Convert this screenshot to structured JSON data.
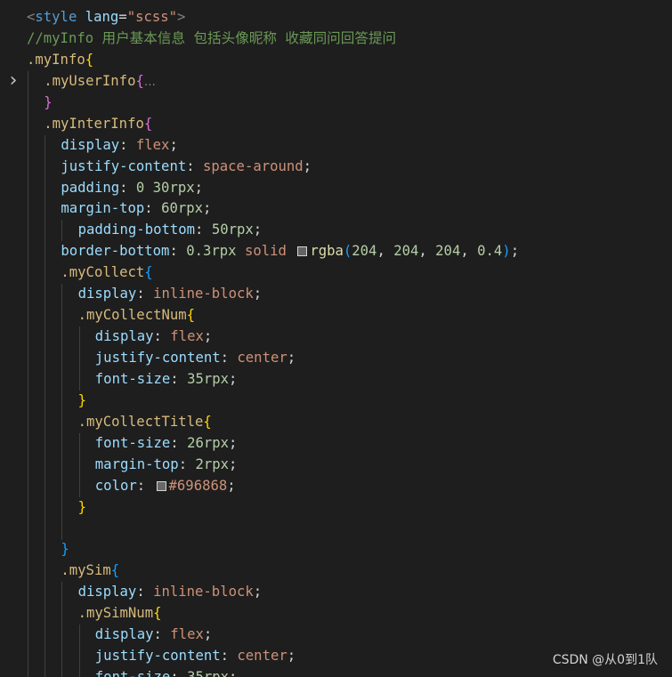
{
  "editor": {
    "language": "scss",
    "lines": [
      {
        "indent": 0,
        "tokens": [
          {
            "t": "<",
            "k": "punc"
          },
          {
            "t": "style",
            "k": "tag"
          },
          {
            "t": " ",
            "k": "text"
          },
          {
            "t": "lang",
            "k": "attr"
          },
          {
            "t": "=",
            "k": "text"
          },
          {
            "t": "\"scss\"",
            "k": "str"
          },
          {
            "t": ">",
            "k": "punc"
          }
        ]
      },
      {
        "indent": 0,
        "tokens": [
          {
            "t": "//myInfo 用户基本信息 包括头像昵称 收藏同问回答提问",
            "k": "comment"
          }
        ]
      },
      {
        "indent": 0,
        "tokens": [
          {
            "t": ".myInfo",
            "k": "sel"
          },
          {
            "t": "{",
            "k": "b1"
          }
        ]
      },
      {
        "indent": 1,
        "fold": "collapsed",
        "tokens": [
          {
            "t": ".myUserInfo",
            "k": "sel"
          },
          {
            "t": "{",
            "k": "b2"
          },
          {
            "t": "…",
            "k": "ellipsis"
          }
        ]
      },
      {
        "indent": 1,
        "tokens": [
          {
            "t": "}",
            "k": "b2"
          }
        ]
      },
      {
        "indent": 1,
        "tokens": [
          {
            "t": ".myInterInfo",
            "k": "sel"
          },
          {
            "t": "{",
            "k": "b2"
          }
        ]
      },
      {
        "indent": 2,
        "tokens": [
          {
            "t": "display",
            "k": "prop"
          },
          {
            "t": ": ",
            "k": "text"
          },
          {
            "t": "flex",
            "k": "value"
          },
          {
            "t": ";",
            "k": "text"
          }
        ]
      },
      {
        "indent": 2,
        "tokens": [
          {
            "t": "justify-content",
            "k": "prop"
          },
          {
            "t": ": ",
            "k": "text"
          },
          {
            "t": "space-around",
            "k": "value"
          },
          {
            "t": ";",
            "k": "text"
          }
        ]
      },
      {
        "indent": 2,
        "tokens": [
          {
            "t": "padding",
            "k": "prop"
          },
          {
            "t": ": ",
            "k": "text"
          },
          {
            "t": "0",
            "k": "num"
          },
          {
            "t": " ",
            "k": "text"
          },
          {
            "t": "30rpx",
            "k": "num"
          },
          {
            "t": ";",
            "k": "text"
          }
        ]
      },
      {
        "indent": 2,
        "tokens": [
          {
            "t": "margin-top",
            "k": "prop"
          },
          {
            "t": ": ",
            "k": "text"
          },
          {
            "t": "60rpx",
            "k": "num"
          },
          {
            "t": ";",
            "k": "text"
          }
        ]
      },
      {
        "indent": 3,
        "tokens": [
          {
            "t": "padding-bottom",
            "k": "prop"
          },
          {
            "t": ": ",
            "k": "text"
          },
          {
            "t": "50rpx",
            "k": "num"
          },
          {
            "t": ";",
            "k": "text"
          }
        ]
      },
      {
        "indent": 2,
        "tokens": [
          {
            "t": "border-bottom",
            "k": "prop"
          },
          {
            "t": ": ",
            "k": "text"
          },
          {
            "t": "0.3rpx",
            "k": "num"
          },
          {
            "t": " ",
            "k": "text"
          },
          {
            "t": "solid",
            "k": "value"
          },
          {
            "t": " ",
            "k": "text"
          },
          {
            "swatch": "rgba(204, 204, 204, 0.4)"
          },
          {
            "t": "rgba",
            "k": "func"
          },
          {
            "t": "(",
            "k": "b3"
          },
          {
            "t": "204",
            "k": "num"
          },
          {
            "t": ", ",
            "k": "text"
          },
          {
            "t": "204",
            "k": "num"
          },
          {
            "t": ", ",
            "k": "text"
          },
          {
            "t": "204",
            "k": "num"
          },
          {
            "t": ", ",
            "k": "text"
          },
          {
            "t": "0.4",
            "k": "num"
          },
          {
            "t": ")",
            "k": "b3"
          },
          {
            "t": ";",
            "k": "text"
          }
        ]
      },
      {
        "indent": 2,
        "tokens": [
          {
            "t": ".myCollect",
            "k": "sel"
          },
          {
            "t": "{",
            "k": "b3"
          }
        ]
      },
      {
        "indent": 3,
        "tokens": [
          {
            "t": "display",
            "k": "prop"
          },
          {
            "t": ": ",
            "k": "text"
          },
          {
            "t": "inline-block",
            "k": "value"
          },
          {
            "t": ";",
            "k": "text"
          }
        ]
      },
      {
        "indent": 3,
        "tokens": [
          {
            "t": ".myCollectNum",
            "k": "sel"
          },
          {
            "t": "{",
            "k": "b1"
          }
        ]
      },
      {
        "indent": 4,
        "tokens": [
          {
            "t": "display",
            "k": "prop"
          },
          {
            "t": ": ",
            "k": "text"
          },
          {
            "t": "flex",
            "k": "value"
          },
          {
            "t": ";",
            "k": "text"
          }
        ]
      },
      {
        "indent": 4,
        "tokens": [
          {
            "t": "justify-content",
            "k": "prop"
          },
          {
            "t": ": ",
            "k": "text"
          },
          {
            "t": "center",
            "k": "value"
          },
          {
            "t": ";",
            "k": "text"
          }
        ]
      },
      {
        "indent": 4,
        "tokens": [
          {
            "t": "font-size",
            "k": "prop"
          },
          {
            "t": ": ",
            "k": "text"
          },
          {
            "t": "35rpx",
            "k": "num"
          },
          {
            "t": ";",
            "k": "text"
          }
        ]
      },
      {
        "indent": 3,
        "tokens": [
          {
            "t": "}",
            "k": "b1"
          }
        ]
      },
      {
        "indent": 3,
        "tokens": [
          {
            "t": ".myCollectTitle",
            "k": "sel"
          },
          {
            "t": "{",
            "k": "b1"
          }
        ]
      },
      {
        "indent": 4,
        "tokens": [
          {
            "t": "font-size",
            "k": "prop"
          },
          {
            "t": ": ",
            "k": "text"
          },
          {
            "t": "26rpx",
            "k": "num"
          },
          {
            "t": ";",
            "k": "text"
          }
        ]
      },
      {
        "indent": 4,
        "tokens": [
          {
            "t": "margin-top",
            "k": "prop"
          },
          {
            "t": ": ",
            "k": "text"
          },
          {
            "t": "2rpx",
            "k": "num"
          },
          {
            "t": ";",
            "k": "text"
          }
        ]
      },
      {
        "indent": 4,
        "tokens": [
          {
            "t": "color",
            "k": "prop"
          },
          {
            "t": ": ",
            "k": "text"
          },
          {
            "swatch": "#696868"
          },
          {
            "t": "#696868",
            "k": "value"
          },
          {
            "t": ";",
            "k": "text"
          }
        ]
      },
      {
        "indent": 3,
        "tokens": [
          {
            "t": "}",
            "k": "b1"
          }
        ]
      },
      {
        "indent": 3,
        "tokens": []
      },
      {
        "indent": 2,
        "tokens": [
          {
            "t": "}",
            "k": "b3"
          }
        ]
      },
      {
        "indent": 2,
        "tokens": [
          {
            "t": ".mySim",
            "k": "sel"
          },
          {
            "t": "{",
            "k": "b3"
          }
        ]
      },
      {
        "indent": 3,
        "tokens": [
          {
            "t": "display",
            "k": "prop"
          },
          {
            "t": ": ",
            "k": "text"
          },
          {
            "t": "inline-block",
            "k": "value"
          },
          {
            "t": ";",
            "k": "text"
          }
        ]
      },
      {
        "indent": 3,
        "tokens": [
          {
            "t": ".mySimNum",
            "k": "sel"
          },
          {
            "t": "{",
            "k": "b1"
          }
        ]
      },
      {
        "indent": 4,
        "tokens": [
          {
            "t": "display",
            "k": "prop"
          },
          {
            "t": ": ",
            "k": "text"
          },
          {
            "t": "flex",
            "k": "value"
          },
          {
            "t": ";",
            "k": "text"
          }
        ]
      },
      {
        "indent": 4,
        "tokens": [
          {
            "t": "justify-content",
            "k": "prop"
          },
          {
            "t": ": ",
            "k": "text"
          },
          {
            "t": "center",
            "k": "value"
          },
          {
            "t": ";",
            "k": "text"
          }
        ]
      },
      {
        "indent": 4,
        "tokens": [
          {
            "t": "font-size",
            "k": "prop"
          },
          {
            "t": ": ",
            "k": "text"
          },
          {
            "t": "35rpx",
            "k": "num"
          },
          {
            "t": ";",
            "k": "text"
          }
        ]
      }
    ]
  },
  "watermark": {
    "text": "CSDN @从0到1队"
  },
  "icons": {
    "fold_collapsed": "chevron-right-icon",
    "color_swatch": "color-swatch-icon"
  }
}
